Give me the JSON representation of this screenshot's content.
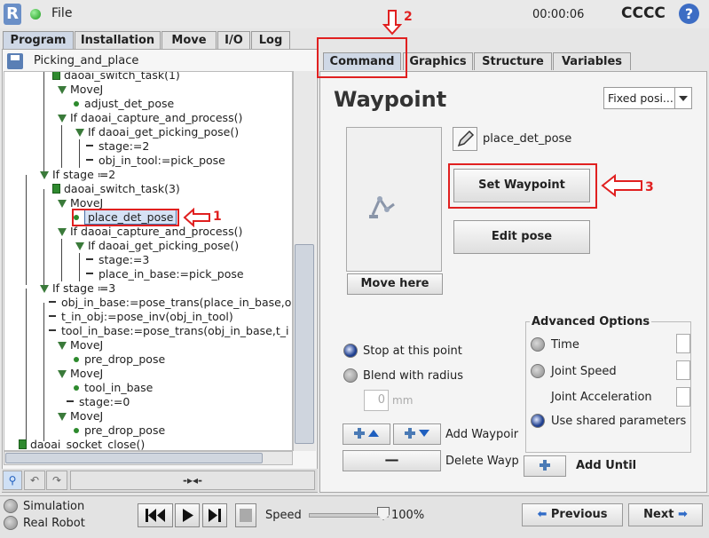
{
  "header": {
    "logo": "R",
    "file_menu": "File",
    "timer": "00:00:06",
    "robot_name": "CCCC",
    "help": "?"
  },
  "main_tabs": [
    "Program",
    "Installation",
    "Move",
    "I/O",
    "Log"
  ],
  "program_name": "Picking_and_place",
  "sub_tabs": [
    "Command",
    "Graphics",
    "Structure",
    "Variables"
  ],
  "tree": [
    {
      "text": "daoai_switch_task(1)",
      "kind": "task"
    },
    {
      "text": "MoveJ",
      "kind": "folder"
    },
    {
      "text": "adjust_det_pose",
      "kind": "point"
    },
    {
      "text": "If daoai_capture_and_process()",
      "kind": "folder"
    },
    {
      "text": "If daoai_get_picking_pose()",
      "kind": "folder"
    },
    {
      "text": "stage:=2",
      "kind": "assign"
    },
    {
      "text": "obj_in_tool:=pick_pose",
      "kind": "assign"
    },
    {
      "text": "If stage ≔2",
      "kind": "folder"
    },
    {
      "text": "daoai_switch_task(3)",
      "kind": "task"
    },
    {
      "text": "MoveJ",
      "kind": "folder"
    },
    {
      "text": "place_det_pose",
      "kind": "point"
    },
    {
      "text": "If daoai_capture_and_process()",
      "kind": "folder"
    },
    {
      "text": "If daoai_get_picking_pose()",
      "kind": "folder"
    },
    {
      "text": "stage:=3",
      "kind": "assign"
    },
    {
      "text": "place_in_base:=pick_pose",
      "kind": "assign"
    },
    {
      "text": "If stage ≔3",
      "kind": "folder"
    },
    {
      "text": "obj_in_base:=pose_trans(place_in_base,o",
      "kind": "assign"
    },
    {
      "text": "t_in_obj:=pose_inv(obj_in_tool)",
      "kind": "assign"
    },
    {
      "text": "tool_in_base:=pose_trans(obj_in_base,t_i",
      "kind": "assign"
    },
    {
      "text": "MoveJ",
      "kind": "folder"
    },
    {
      "text": "pre_drop_pose",
      "kind": "point"
    },
    {
      "text": "MoveJ",
      "kind": "folder"
    },
    {
      "text": "tool_in_base",
      "kind": "point"
    },
    {
      "text": "stage:=0",
      "kind": "assign"
    },
    {
      "text": "MoveJ",
      "kind": "folder"
    },
    {
      "text": "pre_drop_pose",
      "kind": "point"
    },
    {
      "text": "daoai_socket_close()",
      "kind": "task"
    }
  ],
  "tree_toolbar": {
    "playhead": "-▸◂-"
  },
  "waypoint": {
    "title": "Waypoint",
    "mode_select": "Fixed posi...",
    "name": "place_det_pose",
    "set_button": "Set Waypoint",
    "edit_button": "Edit pose",
    "move_here_button": "Move here",
    "stop_label": "Stop at this point",
    "blend_label": "Blend with radius",
    "blend_value": "0",
    "blend_unit": "mm",
    "add_waypoint_label": "Add Waypoir",
    "delete_waypoint_label": "Delete Wayp",
    "add_until_label": "Add Until"
  },
  "advanced": {
    "title": "Advanced Options",
    "time": "Time",
    "joint_speed": "Joint Speed",
    "joint_accel": "Joint Acceleration",
    "shared": "Use shared parameters"
  },
  "bottom": {
    "simulation": "Simulation",
    "real_robot": "Real Robot",
    "speed_label": "Speed",
    "speed_value": "100%",
    "previous": "Previous",
    "next": "Next"
  },
  "annotations": [
    "1",
    "2",
    "3"
  ],
  "colors": {
    "accent": "#3d6dc4",
    "annotation": "#e02020",
    "active_tab": "#cfd8e6"
  }
}
